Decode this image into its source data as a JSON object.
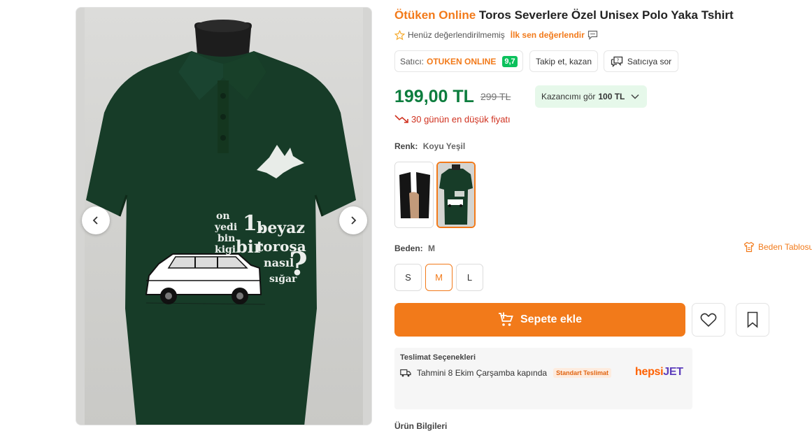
{
  "product": {
    "brand": "Ötüken Online",
    "title": "Toros Severlere Özel Unisex Polo Yaka Tshirt"
  },
  "rating": {
    "not_rated_text": "Henüz değerlendirilmemiş",
    "first_review_link": "İlk sen değerlendir"
  },
  "seller": {
    "label": "Satıcı:",
    "name": "OTUKEN ONLINE",
    "score": "9,7"
  },
  "actions": {
    "follow_label": "Takip et, kazan",
    "ask_seller_label": "Satıcıya sor",
    "add_to_cart_label": "Sepete ekle"
  },
  "price": {
    "current": "199,00 TL",
    "old": "299 TL",
    "earn_label": "Kazancımı gör",
    "earn_value": "100 TL",
    "lowest_text": "30 günün en düşük fiyatı"
  },
  "color": {
    "label": "Renk:",
    "value": "Koyu Yeşil",
    "swatches": [
      "black",
      "dark-green"
    ],
    "selected_index": 1
  },
  "size": {
    "label": "Beden:",
    "value": "M",
    "table_link": "Beden Tablosu",
    "options": [
      "S",
      "M",
      "L"
    ],
    "selected": "M"
  },
  "delivery": {
    "heading": "Teslimat Seçenekleri",
    "estimate": "Tahmini 8 Ekim Çarşamba kapında",
    "badge": "Standart Teslimat",
    "carrier_part1": "hepsi",
    "carrier_part2": "JET"
  },
  "section": {
    "product_info": "Ürün Bilgileri"
  },
  "shirt_print": {
    "left_words": [
      "on",
      "yedi",
      "bin",
      "kigi"
    ],
    "number": "1.",
    "big_word": "bir",
    "lines": [
      "beyaz",
      "torosa",
      "nasıl",
      "sığar"
    ],
    "mark": "?"
  },
  "colors": {
    "accent": "#f27a1a",
    "price_green": "#0d7d3e",
    "score_green": "#0bc15c",
    "alert_red": "#d0311f",
    "shirt_green": "#173c28"
  }
}
